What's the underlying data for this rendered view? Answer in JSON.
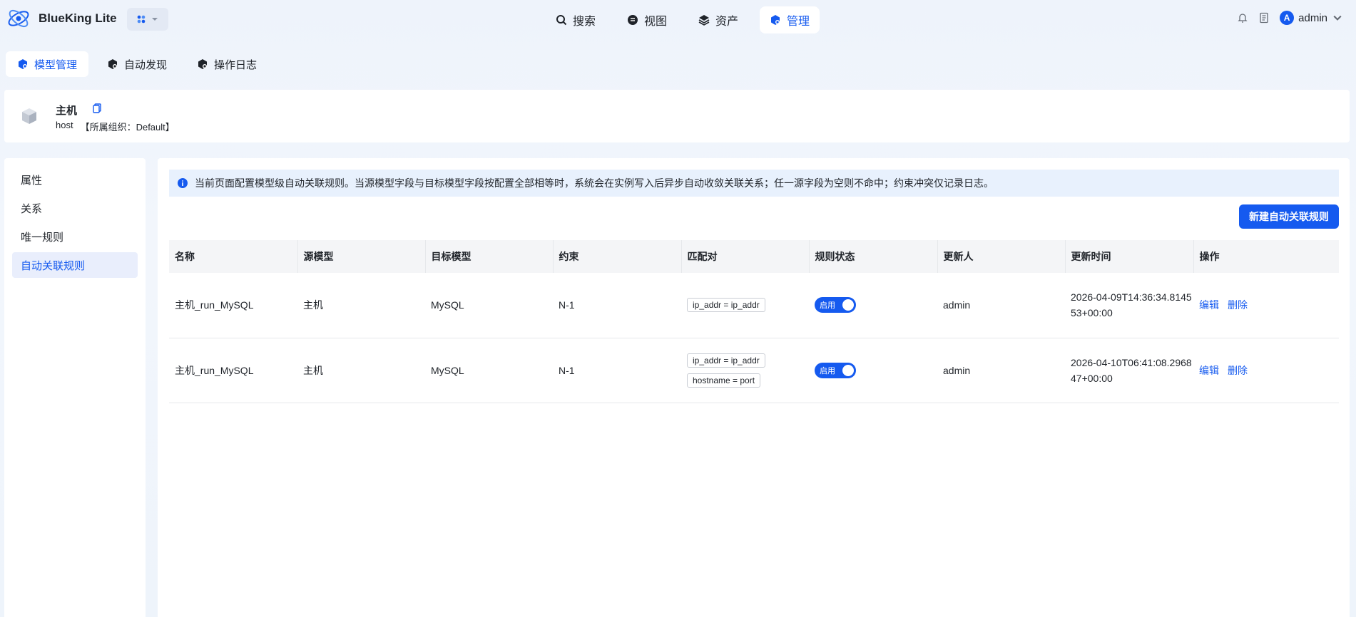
{
  "app": {
    "name": "BlueKing Lite"
  },
  "nav": [
    {
      "label": "搜索",
      "icon": "search-icon"
    },
    {
      "label": "视图",
      "icon": "view-icon"
    },
    {
      "label": "资产",
      "icon": "layers-icon"
    },
    {
      "label": "管理",
      "icon": "manage-icon",
      "active": true
    }
  ],
  "user": {
    "avatar_letter": "A",
    "name": "admin"
  },
  "subtabs": [
    {
      "label": "模型管理",
      "active": true
    },
    {
      "label": "自动发现"
    },
    {
      "label": "操作日志"
    }
  ],
  "model": {
    "title": "主机",
    "id": "host",
    "org": "【所属组织：Default】"
  },
  "left_menu": [
    {
      "label": "属性"
    },
    {
      "label": "关系"
    },
    {
      "label": "唯一规则"
    },
    {
      "label": "自动关联规则",
      "active": true
    }
  ],
  "notice": "当前页面配置模型级自动关联规则。当源模型字段与目标模型字段按配置全部相等时，系统会在实例写入后异步自动收敛关联关系；任一源字段为空则不命中；约束冲突仅记录日志。",
  "create_button": "新建自动关联规则",
  "table": {
    "headers": [
      "名称",
      "源模型",
      "目标模型",
      "约束",
      "匹配对",
      "规则状态",
      "更新人",
      "更新时间",
      "操作"
    ],
    "rows": [
      {
        "name": "主机_run_MySQL",
        "source": "主机",
        "target": "MySQL",
        "constraint": "N-1",
        "pairs": [
          "ip_addr = ip_addr"
        ],
        "status": "启用",
        "updater": "admin",
        "updated": "2026-04-09T14:36:34.814553+00:00",
        "edit": "编辑",
        "delete": "删除"
      },
      {
        "name": "主机_run_MySQL",
        "source": "主机",
        "target": "MySQL",
        "constraint": "N-1",
        "pairs": [
          "ip_addr = ip_addr",
          "hostname = port"
        ],
        "status": "启用",
        "updater": "admin",
        "updated": "2026-04-10T06:41:08.296847+00:00",
        "edit": "编辑",
        "delete": "删除"
      }
    ]
  },
  "colors": {
    "primary": "#155aef",
    "notice_bg": "#e8f1fd"
  }
}
